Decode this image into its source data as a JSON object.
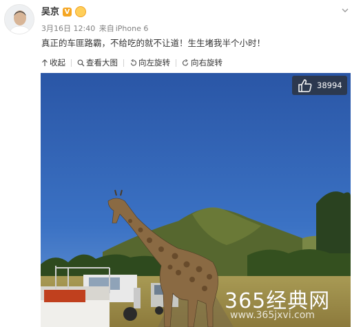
{
  "post": {
    "author": "吴京",
    "verified_icon": "v-verified-icon",
    "medal_icon": "member-medal-icon",
    "timestamp": "3月16日 12:40",
    "source_prefix": "来自",
    "source": "iPhone 6",
    "text": "真正的车匪路霸，不给吃的就不让道！生生堵我半个小时！"
  },
  "toolbar": {
    "collapse": "收起",
    "view_large": "查看大图",
    "rotate_left": "向左旋转",
    "rotate_right": "向右旋转"
  },
  "photo": {
    "likes": "38994",
    "watermark": "365经典网",
    "watermark_url": "www.365jxvi.com"
  },
  "colors": {
    "sky": "#2f5fae",
    "accent": "#f5a623",
    "meta_gray": "#808080"
  }
}
